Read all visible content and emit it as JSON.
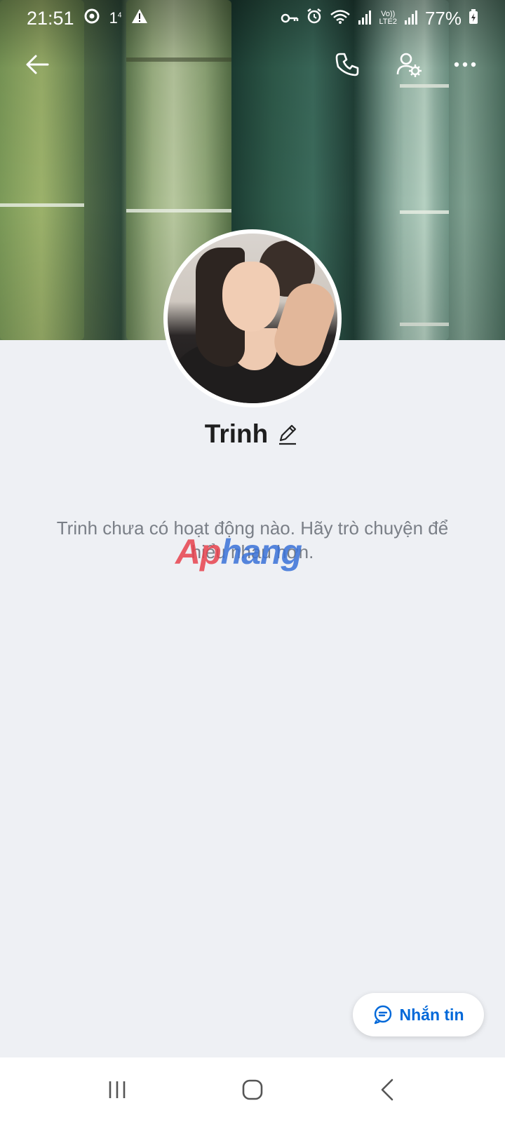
{
  "status_bar": {
    "time": "21:51",
    "notif_icons": [
      "chrome-icon",
      "one-icon",
      "warning-icon"
    ],
    "right_icons": [
      "key-icon",
      "alarm-icon",
      "wifi-icon",
      "signal-icon",
      "volte-icon",
      "signal-icon"
    ],
    "volte_label_top": "Vo))",
    "volte_label_bottom": "LTE2",
    "battery": "77%"
  },
  "header": {
    "back_icon": "arrow-left-icon",
    "call_icon": "phone-icon",
    "settings_icon": "user-settings-icon",
    "more_icon": "more-horizontal-icon"
  },
  "profile": {
    "name": "Trinh",
    "edit_icon": "pencil-icon",
    "empty_message": "Trinh chưa có hoạt động nào. Hãy trò chuyện để hiểu nhau hơn."
  },
  "watermark": {
    "part1": "Ap",
    "part2": "hang"
  },
  "message_button": {
    "label": "Nhắn tin",
    "icon": "chat-icon",
    "color": "#0068d9"
  },
  "nav_bar": {
    "items": [
      "recent-apps-icon",
      "home-icon",
      "back-icon"
    ]
  },
  "colors": {
    "background": "#eef0f4",
    "accent": "#0068d9"
  }
}
